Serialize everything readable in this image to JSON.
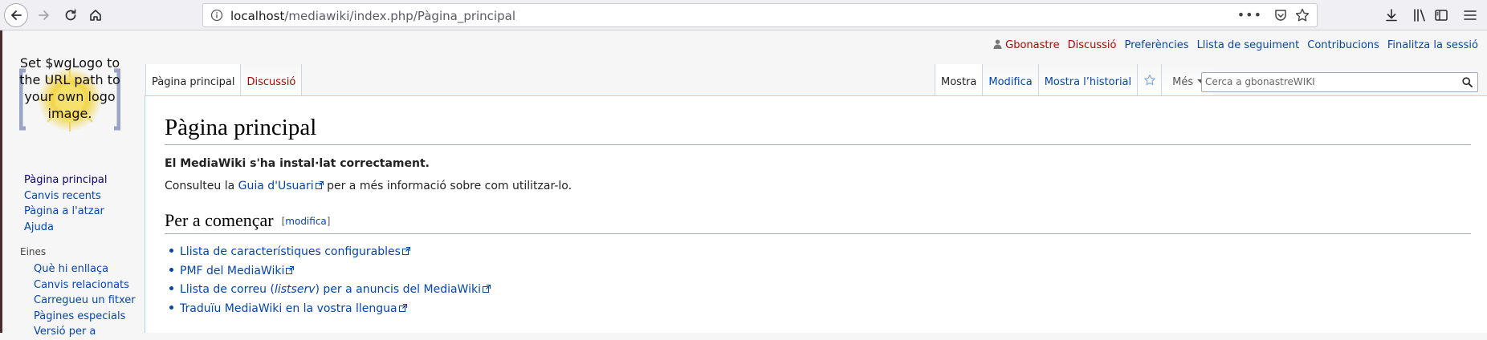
{
  "browser": {
    "url_host": "localhost",
    "url_path": "/mediawiki/index.php/Pàgina_principal",
    "page_actions_label": "•••"
  },
  "logo": {
    "text": "Set $wgLogo to the URL path to your own logo image."
  },
  "personal": {
    "username": "Gbonastre",
    "talk": "Discussió",
    "preferences": "Preferències",
    "watchlist": "Llista de seguiment",
    "contributions": "Contribucions",
    "logout": "Finalitza la sessió"
  },
  "tabs": {
    "page": "Pàgina principal",
    "talk": "Discussió",
    "view": "Mostra",
    "edit": "Modifica",
    "history": "Mostra l’historial",
    "more": "Més"
  },
  "search": {
    "placeholder": "Cerca a gbonastreWIKI"
  },
  "sidebar": {
    "navigation": [
      "Pàgina principal",
      "Canvis recents",
      "Pàgina a l'atzar",
      "Ajuda"
    ],
    "tools_heading": "Eines",
    "tools": [
      "Què hi enllaça",
      "Canvis relacionats",
      "Carregueu un fitxer",
      "Pàgines especials",
      "Versió per a"
    ]
  },
  "content": {
    "title": "Pàgina principal",
    "lead": "El MediaWiki s'ha instal·lat correctament.",
    "para_before": "Consulteu la ",
    "para_link": "Guia d'Usuari",
    "para_after": " per a més informació sobre com utilitzar-lo.",
    "section_title": "Per a començar",
    "section_edit_open": "[",
    "section_edit": "modifica",
    "section_edit_close": "]",
    "links": {
      "l1": "Llista de característiques configurables",
      "l2": "PMF del MediaWiki",
      "l3_before": "Llista de correu (",
      "l3_italic": "listserv",
      "l3_after": ") per a anuncis del MediaWiki",
      "l4": "Traduïu MediaWiki en la vostra llengua"
    }
  },
  "colors": {
    "link": "#0645ad",
    "redlink": "#ba0000",
    "content_border": "#a7d7f9"
  }
}
